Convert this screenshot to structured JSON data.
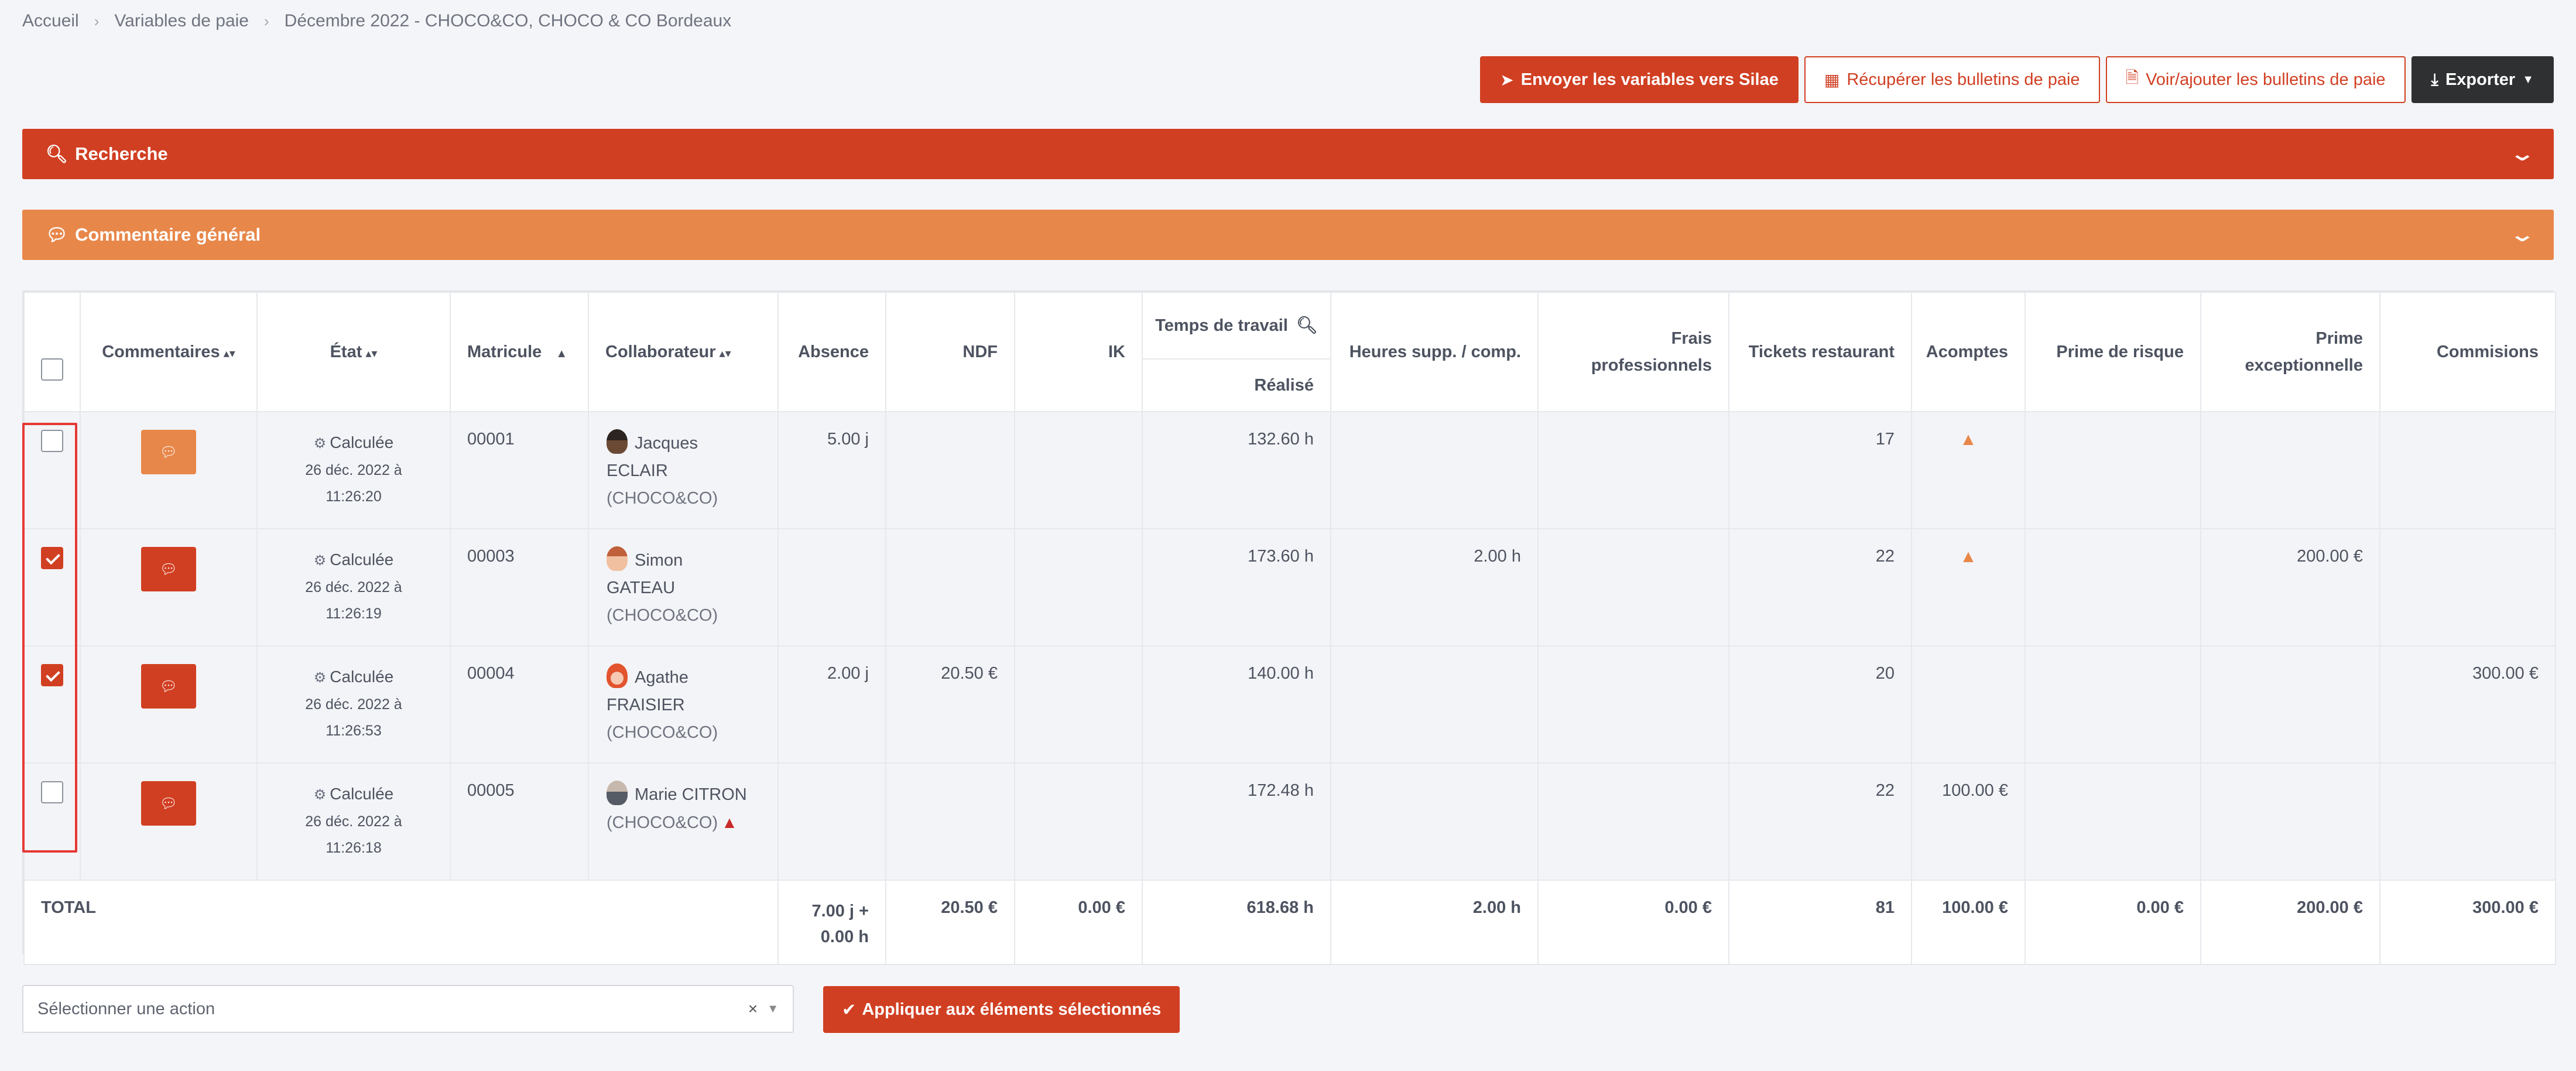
{
  "breadcrumb": [
    "Accueil",
    "Variables de paie",
    "Décembre 2022 - CHOCO&CO, CHOCO & CO Bordeaux"
  ],
  "toolbar": {
    "send": "Envoyer les variables vers Silae",
    "fetch": "Récupérer les bulletins de paie",
    "view": "Voir/ajouter les bulletins de paie",
    "export": "Exporter"
  },
  "panels": {
    "search": "Recherche",
    "comment": "Commentaire général"
  },
  "table": {
    "headers": {
      "comments": "Commentaires",
      "state": "État",
      "matricule": "Matricule",
      "collab": "Collaborateur",
      "absence": "Absence",
      "ndf": "NDF",
      "ik": "IK",
      "work_time": "Temps de travail",
      "realized": "Réalisé",
      "overtime": "Heures supp. / comp.",
      "fees_1": "Frais",
      "fees_2": "professionnels",
      "tickets": "Tickets restaurant",
      "advances": "Acomptes",
      "risk": "Prime de risque",
      "bonus_1": "Prime",
      "bonus_2": "exceptionnelle",
      "commissions": "Commisions"
    },
    "rows": [
      {
        "checked": false,
        "state": "Calculée",
        "date1": "26 déc. 2022 à",
        "date2": "11:26:20",
        "matricule": "00001",
        "first": "Jacques",
        "last": "ECLAIR",
        "company": "(CHOCO&CO)",
        "absence": "5.00 j",
        "ndf": "",
        "ik": "",
        "realized": "132.60 h",
        "overtime": "",
        "fees": "",
        "tickets": "17",
        "advances": "",
        "risk": "",
        "bonus": "",
        "commissions": ""
      },
      {
        "checked": true,
        "state": "Calculée",
        "date1": "26 déc. 2022 à",
        "date2": "11:26:19",
        "matricule": "00003",
        "first": "Simon",
        "last": "GATEAU",
        "company": "(CHOCO&CO)",
        "absence": "",
        "ndf": "",
        "ik": "",
        "realized": "173.60 h",
        "overtime": "2.00 h",
        "fees": "",
        "tickets": "22",
        "advances": "",
        "risk": "",
        "bonus": "200.00 €",
        "commissions": ""
      },
      {
        "checked": true,
        "state": "Calculée",
        "date1": "26 déc. 2022 à",
        "date2": "11:26:53",
        "matricule": "00004",
        "first": "Agathe",
        "last": "FRAISIER",
        "company": "(CHOCO&CO)",
        "absence": "2.00 j",
        "ndf": "20.50 €",
        "ik": "",
        "realized": "140.00 h",
        "overtime": "",
        "fees": "",
        "tickets": "20",
        "advances": "",
        "risk": "",
        "bonus": "",
        "commissions": "300.00 €"
      },
      {
        "checked": false,
        "state": "Calculée",
        "date1": "26 déc. 2022 à",
        "date2": "11:26:18",
        "matricule": "00005",
        "first": "Marie CITRON",
        "last": "",
        "company": "(CHOCO&CO)",
        "absence": "",
        "ndf": "",
        "ik": "",
        "realized": "172.48 h",
        "overtime": "",
        "fees": "",
        "tickets": "22",
        "advances": "100.00 €",
        "risk": "",
        "bonus": "",
        "commissions": ""
      }
    ],
    "total": {
      "label": "TOTAL",
      "absence_1": "7.00 j +",
      "absence_2": "0.00 h",
      "ndf": "20.50 €",
      "ik": "0.00 €",
      "realized": "618.68 h",
      "overtime": "2.00 h",
      "fees": "0.00 €",
      "tickets": "81",
      "advances": "100.00 €",
      "risk": "0.00 €",
      "bonus": "200.00 €",
      "commissions": "300.00 €"
    }
  },
  "actions": {
    "placeholder": "Sélectionner une action",
    "clear": "×",
    "apply": "Appliquer aux éléments sélectionnés"
  },
  "colors": {
    "primary": "#d13f22",
    "secondary": "#e8874a",
    "dark": "#2f3032",
    "highlight": "#e53935"
  },
  "icons": [
    "paper-plane-icon",
    "calculator-icon",
    "file-icon",
    "download-icon",
    "search-icon",
    "comment-icon",
    "chevron-down-icon",
    "gears-icon",
    "warning-icon",
    "check-circle-icon",
    "magnify-icon"
  ]
}
